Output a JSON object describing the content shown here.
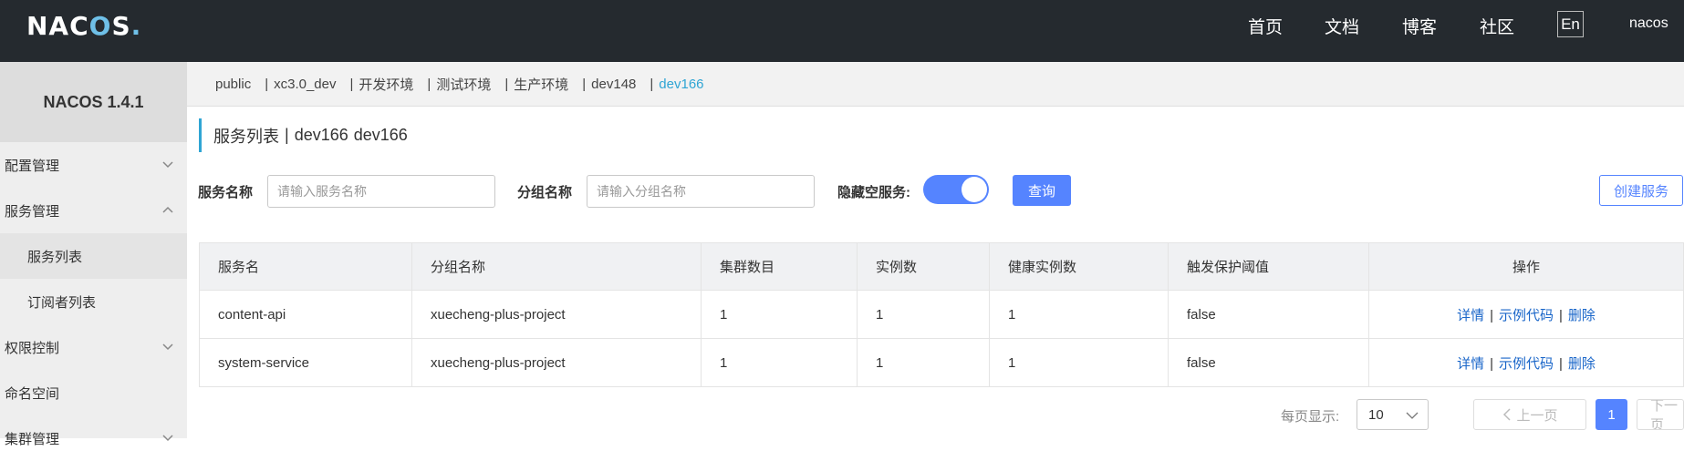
{
  "header": {
    "logo": {
      "n": "NA",
      "c": "C",
      "o": "O",
      "s": "S",
      "dot": "."
    },
    "nav": [
      "首页",
      "文档",
      "博客",
      "社区"
    ],
    "lang": "En",
    "user": "nacos"
  },
  "sidebar": {
    "title": "NACOS 1.4.1",
    "items": [
      {
        "label": "配置管理",
        "icon": "chevron-down-icon"
      },
      {
        "label": "服务管理",
        "icon": "chevron-up-icon"
      },
      {
        "label": "服务列表"
      },
      {
        "label": "订阅者列表"
      },
      {
        "label": "权限控制",
        "icon": "chevron-down-icon"
      },
      {
        "label": "命名空间"
      },
      {
        "label": "集群管理",
        "icon": "chevron-down-icon"
      }
    ]
  },
  "namespaces": {
    "items": [
      "public",
      "xc3.0_dev",
      "开发环境",
      "测试环境",
      "生产环境",
      "dev148",
      "dev166"
    ],
    "separator": "|",
    "active": "dev166"
  },
  "page": {
    "title": "服务列表",
    "sep": "|",
    "ns_name": "dev166",
    "ns_id": "dev166"
  },
  "filter": {
    "service_label": "服务名称",
    "service_placeholder": "请输入服务名称",
    "group_label": "分组名称",
    "group_placeholder": "请输入分组名称",
    "hide_empty_label": "隐藏空服务:",
    "hide_empty_on": true,
    "query_button": "查询",
    "create_button": "创建服务"
  },
  "table": {
    "columns": [
      "服务名",
      "分组名称",
      "集群数目",
      "实例数",
      "健康实例数",
      "触发保护阈值",
      "操作"
    ],
    "rows": [
      {
        "name": "content-api",
        "group": "xuecheng-plus-project",
        "clusters": "1",
        "instances": "1",
        "healthy": "1",
        "threshold": "false"
      },
      {
        "name": "system-service",
        "group": "xuecheng-plus-project",
        "clusters": "1",
        "instances": "1",
        "healthy": "1",
        "threshold": "false"
      }
    ],
    "ops": {
      "detail": "详情",
      "sample": "示例代码",
      "delete": "删除",
      "sep": "|"
    }
  },
  "pagination": {
    "page_size_label": "每页显示:",
    "page_size": "10",
    "prev": "上一页",
    "current": "1",
    "next": "下一页"
  },
  "colors": {
    "header_bg": "#252a2f",
    "accent": "#5584ff",
    "active_ns": "#2fa5d4",
    "link": "#1a66c9"
  }
}
